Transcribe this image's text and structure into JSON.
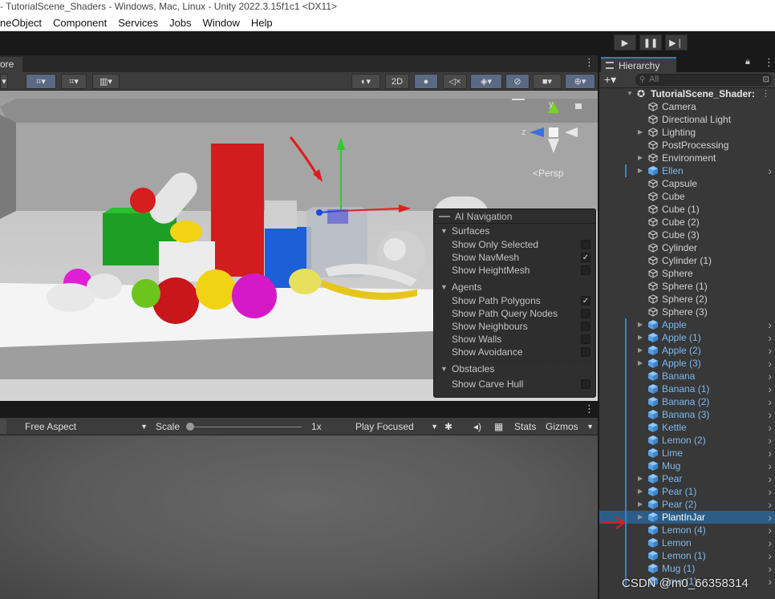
{
  "window": {
    "title": "- TutorialScene_Shaders - Windows, Mac, Linux - Unity 2022.3.15f1c1 <DX11>"
  },
  "menu": [
    "neObject",
    "Component",
    "Services",
    "Jobs",
    "Window",
    "Help"
  ],
  "play_controls": [
    "play-icon",
    "pause-icon",
    "step-icon"
  ],
  "scene": {
    "tab_label": "ore",
    "toolbar": {
      "mode_2d": "2D"
    },
    "gizmo": {
      "y": "y",
      "z": "z",
      "persp": "<Persp"
    }
  },
  "ai_navigation": {
    "title": "AI Navigation",
    "sections": [
      {
        "name": "Surfaces",
        "rows": [
          {
            "label": "Show Only Selected",
            "checked": false
          },
          {
            "label": "Show NavMesh",
            "checked": true
          },
          {
            "label": "Show HeightMesh",
            "checked": false
          }
        ]
      },
      {
        "name": "Agents",
        "rows": [
          {
            "label": "Show Path Polygons",
            "checked": true
          },
          {
            "label": "Show Path Query Nodes",
            "checked": false
          },
          {
            "label": "Show Neighbours",
            "checked": false
          },
          {
            "label": "Show Walls",
            "checked": false
          },
          {
            "label": "Show Avoidance",
            "checked": false
          }
        ]
      },
      {
        "name": "Obstacles",
        "rows": [
          {
            "label": "Show Carve Hull",
            "checked": false
          }
        ]
      }
    ]
  },
  "game": {
    "aspect": "Free Aspect",
    "scale_label": "Scale",
    "scale_value": "1x",
    "play_mode": "Play Focused",
    "stats": "Stats",
    "gizmos": "Gizmos"
  },
  "hierarchy": {
    "tab": "Hierarchy",
    "search_placeholder": "All",
    "scene_name": "TutorialScene_Shader:",
    "items": [
      {
        "label": "Camera",
        "prefab": false,
        "foldout": false,
        "children": false,
        "bar": false
      },
      {
        "label": "Directional Light",
        "prefab": false,
        "foldout": false,
        "children": false,
        "bar": false
      },
      {
        "label": "Lighting",
        "prefab": false,
        "foldout": true,
        "children": false,
        "bar": false
      },
      {
        "label": "PostProcessing",
        "prefab": false,
        "foldout": false,
        "children": false,
        "bar": false
      },
      {
        "label": "Environment",
        "prefab": false,
        "foldout": true,
        "children": false,
        "bar": false
      },
      {
        "label": "Ellen",
        "prefab": true,
        "foldout": true,
        "children": true,
        "bar": true
      },
      {
        "label": "Capsule",
        "prefab": false,
        "foldout": false,
        "children": false,
        "bar": false
      },
      {
        "label": "Cube",
        "prefab": false,
        "foldout": false,
        "children": false,
        "bar": false
      },
      {
        "label": "Cube (1)",
        "prefab": false,
        "foldout": false,
        "children": false,
        "bar": false
      },
      {
        "label": "Cube (2)",
        "prefab": false,
        "foldout": false,
        "children": false,
        "bar": false
      },
      {
        "label": "Cube (3)",
        "prefab": false,
        "foldout": false,
        "children": false,
        "bar": false
      },
      {
        "label": "Cylinder",
        "prefab": false,
        "foldout": false,
        "children": false,
        "bar": false
      },
      {
        "label": "Cylinder (1)",
        "prefab": false,
        "foldout": false,
        "children": false,
        "bar": false
      },
      {
        "label": "Sphere",
        "prefab": false,
        "foldout": false,
        "children": false,
        "bar": false
      },
      {
        "label": "Sphere (1)",
        "prefab": false,
        "foldout": false,
        "children": false,
        "bar": false
      },
      {
        "label": "Sphere (2)",
        "prefab": false,
        "foldout": false,
        "children": false,
        "bar": false
      },
      {
        "label": "Sphere (3)",
        "prefab": false,
        "foldout": false,
        "children": false,
        "bar": false
      },
      {
        "label": "Apple",
        "prefab": true,
        "foldout": true,
        "children": true,
        "bar": true
      },
      {
        "label": "Apple (1)",
        "prefab": true,
        "foldout": true,
        "children": true,
        "bar": true
      },
      {
        "label": "Apple (2)",
        "prefab": true,
        "foldout": true,
        "children": true,
        "bar": true
      },
      {
        "label": "Apple (3)",
        "prefab": true,
        "foldout": true,
        "children": true,
        "bar": true
      },
      {
        "label": "Banana",
        "prefab": true,
        "foldout": false,
        "children": true,
        "bar": true
      },
      {
        "label": "Banana (1)",
        "prefab": true,
        "foldout": false,
        "children": true,
        "bar": true
      },
      {
        "label": "Banana (2)",
        "prefab": true,
        "foldout": false,
        "children": true,
        "bar": true
      },
      {
        "label": "Banana (3)",
        "prefab": true,
        "foldout": false,
        "children": true,
        "bar": true
      },
      {
        "label": "Kettle",
        "prefab": true,
        "foldout": false,
        "children": true,
        "bar": true
      },
      {
        "label": "Lemon (2)",
        "prefab": true,
        "foldout": false,
        "children": true,
        "bar": true
      },
      {
        "label": "Lime",
        "prefab": true,
        "foldout": false,
        "children": true,
        "bar": true
      },
      {
        "label": "Mug",
        "prefab": true,
        "foldout": false,
        "children": true,
        "bar": true
      },
      {
        "label": "Pear",
        "prefab": true,
        "foldout": true,
        "children": true,
        "bar": true
      },
      {
        "label": "Pear (1)",
        "prefab": true,
        "foldout": true,
        "children": true,
        "bar": true
      },
      {
        "label": "Pear (2)",
        "prefab": true,
        "foldout": true,
        "children": true,
        "bar": true
      },
      {
        "label": "PlantInJar",
        "prefab": true,
        "foldout": true,
        "children": true,
        "bar": true,
        "selected": true
      },
      {
        "label": "Lemon (4)",
        "prefab": true,
        "foldout": false,
        "children": true,
        "bar": true
      },
      {
        "label": "Lemon",
        "prefab": true,
        "foldout": false,
        "children": true,
        "bar": true
      },
      {
        "label": "Lemon (1)",
        "prefab": true,
        "foldout": false,
        "children": true,
        "bar": true
      },
      {
        "label": "Mug (1)",
        "prefab": true,
        "foldout": false,
        "children": true,
        "bar": true
      },
      {
        "label": "Lime (1)",
        "prefab": true,
        "foldout": false,
        "children": true,
        "bar": true
      }
    ]
  },
  "watermark": "CSDN @m0_66358314",
  "colors": {
    "accent": "#3a79bb",
    "selected": "#2c5d87",
    "prefab": "#7cb9f0"
  }
}
